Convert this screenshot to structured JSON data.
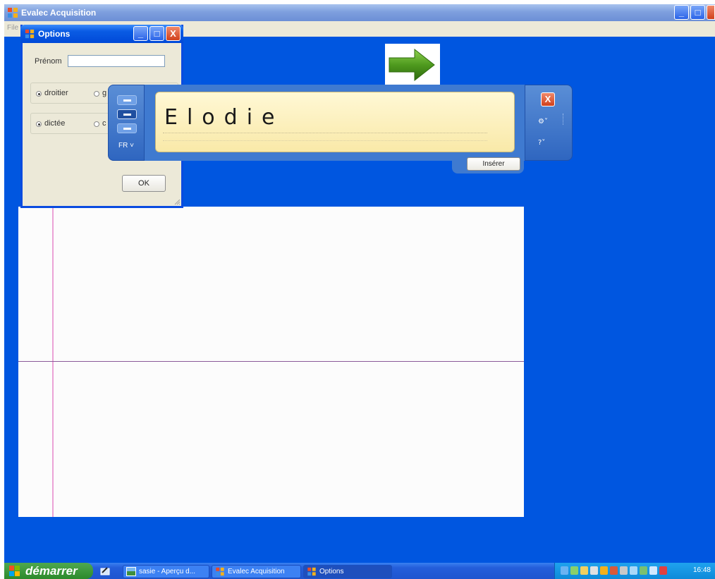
{
  "main_window": {
    "title": "Evalec Acquisition",
    "menu_file": "File",
    "controls": {
      "minimize": "_",
      "maximize": "□",
      "close": "X"
    }
  },
  "options_dialog": {
    "title": "Options",
    "prenom_label": "Prénom",
    "prenom_value": "",
    "hand_option1": "droitier",
    "hand_option2": "g",
    "mode_option1": "dictée",
    "mode_option2": "c",
    "ok_label": "OK",
    "controls": {
      "minimize": "_",
      "maximize": "□",
      "close": "X"
    }
  },
  "tip_panel": {
    "recognized_text": "Elodie",
    "language": "FR ˅",
    "insert_label": "Insérer",
    "close": "X",
    "tool1": "⚙˅",
    "tool2": "?˅"
  },
  "taskbar": {
    "start_label": "démarrer",
    "tasks": [
      {
        "label": "sasie - Aperçu d..."
      },
      {
        "label": "Evalec Acquisition"
      },
      {
        "label": "Options"
      }
    ],
    "clock": "16:48"
  },
  "colors": {
    "desktop_blue": "#0056e0",
    "xp_title_blue": "#0049d8",
    "start_green": "#2c8a2c",
    "arrow_green": "#4e9a1e"
  }
}
